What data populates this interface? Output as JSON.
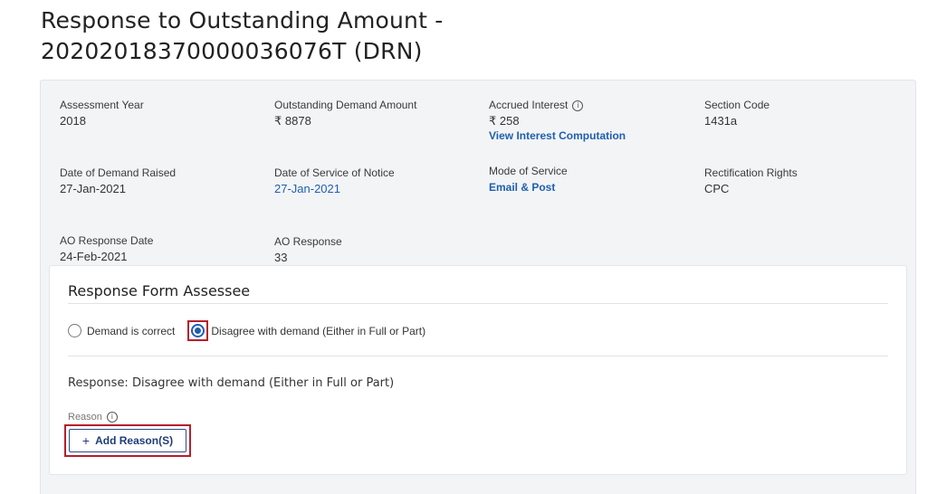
{
  "page": {
    "title_line1": "Response to Outstanding Amount -",
    "title_line2": "20202018370000036076T (DRN)"
  },
  "details": {
    "assessment_year": {
      "label": "Assessment Year",
      "value": "2018"
    },
    "outstanding_demand": {
      "label": "Outstanding Demand Amount",
      "value": "₹ 8878"
    },
    "accrued_interest": {
      "label": "Accrued Interest",
      "value": "₹ 258",
      "link": "View Interest Computation",
      "icon": "info-icon"
    },
    "section_code": {
      "label": "Section Code",
      "value": "1431a"
    },
    "date_demand_raised": {
      "label": "Date of Demand Raised",
      "value": "27-Jan-2021"
    },
    "date_service_notice": {
      "label": "Date of Service of Notice",
      "value": "27-Jan-2021"
    },
    "mode_of_service": {
      "label": "Mode of Service",
      "value": "Email & Post"
    },
    "rectification_rights": {
      "label": "Rectification Rights",
      "value": "CPC"
    },
    "ao_response_date": {
      "label": "AO Response Date",
      "value": "24-Feb-2021"
    },
    "ao_response": {
      "label": "AO Response",
      "value": "33"
    }
  },
  "form": {
    "heading": "Response Form Assessee",
    "options": [
      {
        "label": "Demand is correct",
        "checked": false
      },
      {
        "label": "Disagree with demand (Either in Full or Part)",
        "checked": true
      }
    ],
    "response_text": "Response: Disagree with demand (Either in Full or Part)",
    "reason_label": "Reason",
    "add_reason_label": "Add Reason(S)",
    "add_reason_icon": "+"
  },
  "colors": {
    "accent": "#1f5fb0",
    "highlight": "#b81e2a"
  }
}
